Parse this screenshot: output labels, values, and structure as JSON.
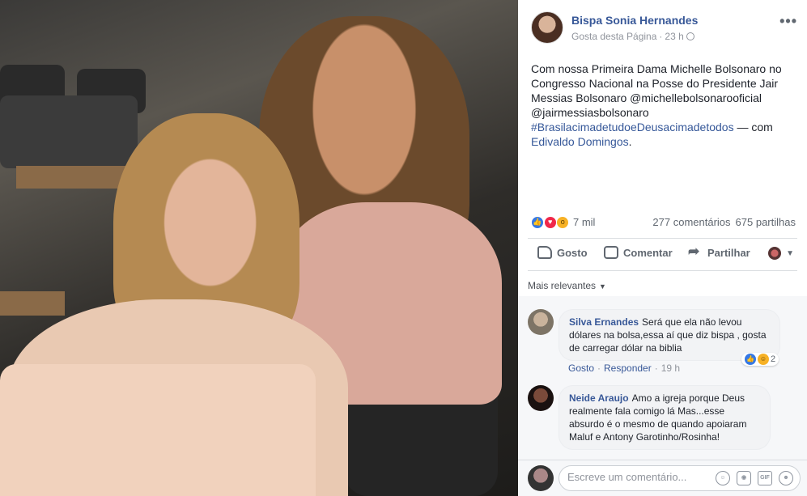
{
  "post": {
    "author": "Bispa Sonia Hernandes",
    "meta_follow": "Gosta desta Página",
    "meta_sep": "·",
    "time": "23 h",
    "text_main": "Com nossa Primeira Dama Michelle Bolsonaro no Congresso Nacional na Posse do Presidente Jair Messias Bolsonaro @michellebolsonarooficial @jairmessiasbolsonaro",
    "hashtag": "#BrasilacimadetudoeDeusacimadetodos",
    "with_prefix": " — com ",
    "tagged": "Edivaldo Domingos",
    "tagged_suffix": "."
  },
  "stats": {
    "reactions": "7 mil",
    "comments": "277 comentários",
    "shares": "675 partilhas"
  },
  "actions": {
    "like": "Gosto",
    "comment": "Comentar",
    "share": "Partilhar"
  },
  "sort": {
    "label": "Mais relevantes"
  },
  "comments": [
    {
      "name": "Silva Ernandes",
      "text": "Será que ela não levou dólares na bolsa,essa aí que diz bispa , gosta de carregar dólar na biblia",
      "reaction_count": "2",
      "like": "Gosto",
      "reply": "Responder",
      "time": "19 h",
      "dot": "·"
    },
    {
      "name": "Neide Araujo",
      "text": "Amo a igreja porque Deus realmente fala comigo lá Mas...esse absurdo é o mesmo de quando apoiaram Maluf e Antony Garotinho/Rosinha!"
    }
  ],
  "composer": {
    "placeholder": "Escreve um comentário..."
  },
  "icons": {
    "more": "more-icon",
    "globe": "globe-icon",
    "like": "thumb-up-icon",
    "comment": "comment-bubble-icon",
    "share": "share-arrow-icon",
    "emoji": "emoji-icon",
    "camera": "camera-icon",
    "gif": "gif-icon",
    "sticker": "sticker-icon"
  },
  "colors": {
    "link": "#385898",
    "muted": "#90949c",
    "like_blue": "#3578e5",
    "love_red": "#f0284a"
  }
}
